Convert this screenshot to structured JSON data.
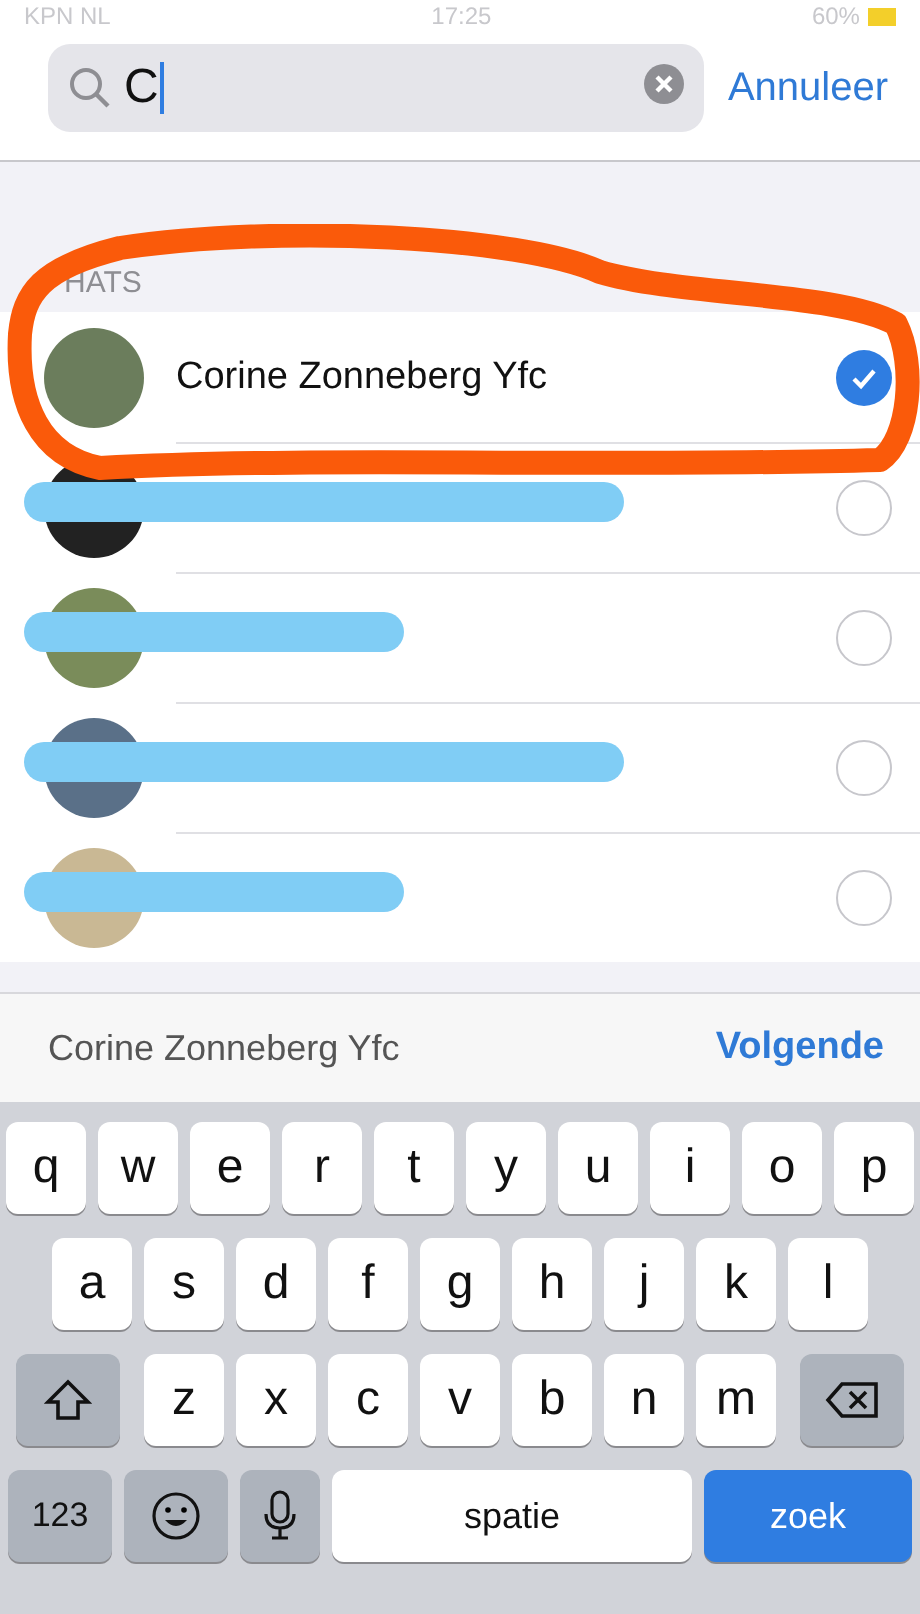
{
  "status_bar": {
    "carrier": "KPN NL",
    "time": "17:25",
    "battery": "60%"
  },
  "search": {
    "value": "C",
    "cancel": "Annuleer"
  },
  "section_header": "HATS",
  "chats": [
    {
      "kind": "contact",
      "name": "Corine Zonneberg Yfc",
      "selected": true
    },
    {
      "kind": "redacted",
      "selected": false
    },
    {
      "kind": "redacted",
      "selected": false
    },
    {
      "kind": "redacted",
      "selected": false
    },
    {
      "kind": "redacted",
      "selected": false
    }
  ],
  "selection_bar": {
    "names": "Corine Zonneberg Yfc",
    "next": "Volgende"
  },
  "keyboard": {
    "rows": [
      [
        "q",
        "w",
        "e",
        "r",
        "t",
        "y",
        "u",
        "i",
        "o",
        "p"
      ],
      [
        "a",
        "s",
        "d",
        "f",
        "g",
        "h",
        "j",
        "k",
        "l"
      ],
      [
        "z",
        "x",
        "c",
        "v",
        "b",
        "n",
        "m"
      ]
    ],
    "numbers": "123",
    "space": "spatie",
    "go": "zoek"
  }
}
